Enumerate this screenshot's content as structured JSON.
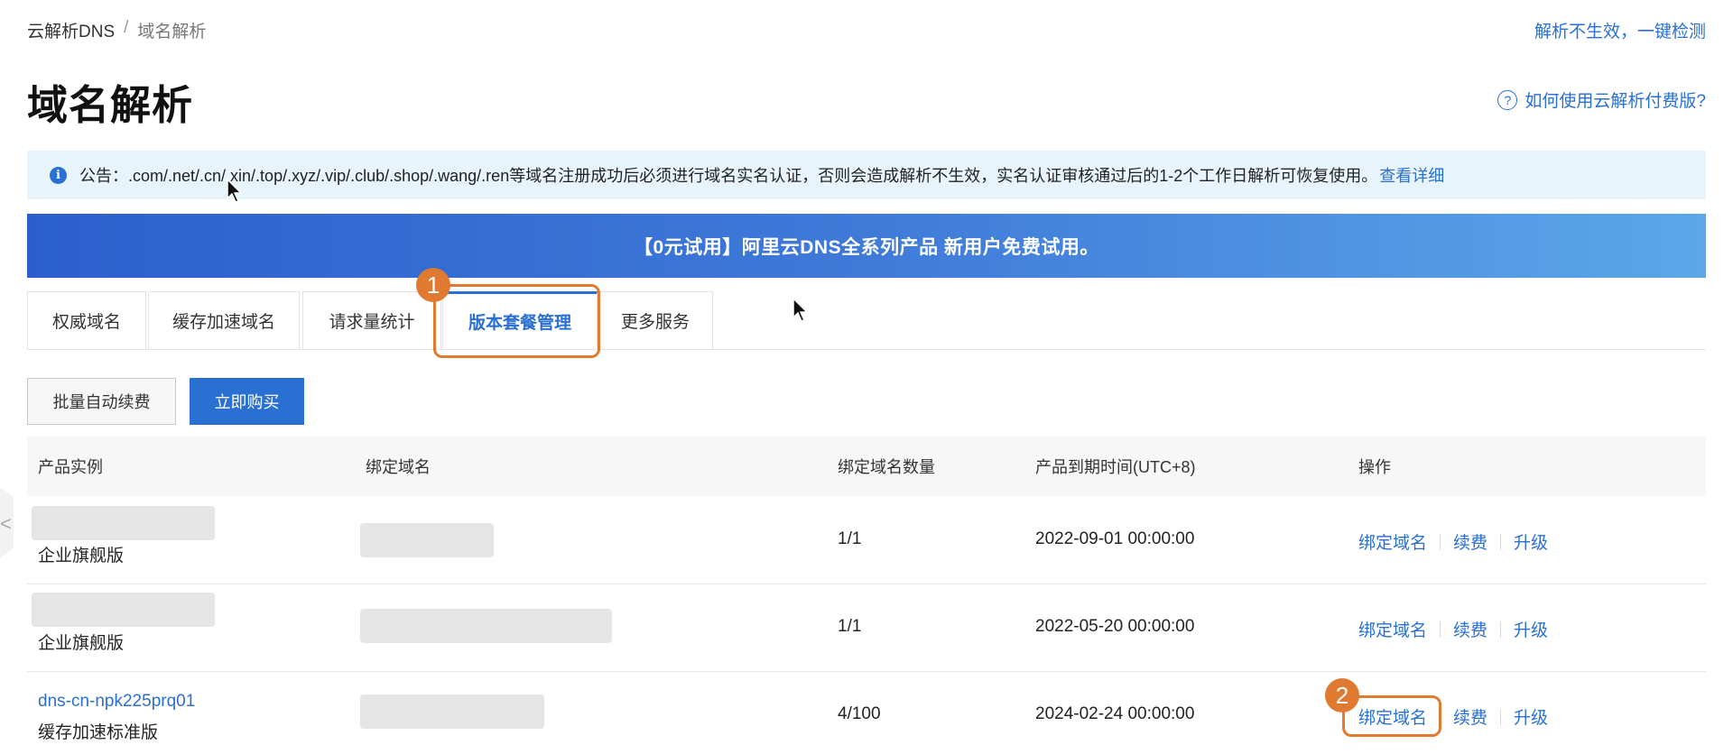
{
  "breadcrumb": {
    "root": "云解析DNS",
    "separator": "/",
    "current": "域名解析"
  },
  "top_link": "解析不生效，一键检测",
  "page_title": "域名解析",
  "help_link": "如何使用云解析付费版?",
  "help_icon": "?",
  "notice": {
    "icon": "i",
    "text": "公告：.com/.net/.cn/.xin/.top/.xyz/.vip/.club/.shop/.wang/.ren等域名注册成功后必须进行域名实名认证，否则会造成解析不生效，实名认证审核通过后的1-2个工作日解析可恢复使用。",
    "link": "查看详细"
  },
  "banner": "【0元试用】阿里云DNS全系列产品 新用户免费试用。",
  "tabs": [
    {
      "label": "权威域名"
    },
    {
      "label": "缓存加速域名"
    },
    {
      "label": "请求量统计"
    },
    {
      "label": "版本套餐管理"
    },
    {
      "label": "更多服务"
    }
  ],
  "buttons": {
    "batch_renew": "批量自动续费",
    "buy_now": "立即购买"
  },
  "table": {
    "headers": [
      "产品实例",
      "绑定域名",
      "绑定域名数量",
      "产品到期时间(UTC+8)",
      "操作"
    ],
    "rows": [
      {
        "instance": "",
        "type": "企业旗舰版",
        "count": "1/1",
        "expiry": "2022-09-01 00:00:00"
      },
      {
        "instance": "",
        "type": "企业旗舰版",
        "count": "1/1",
        "expiry": "2022-05-20 00:00:00"
      },
      {
        "instance": "dns-cn-npk225prq01",
        "type": "缓存加速标准版",
        "count": "4/100",
        "expiry": "2024-02-24 00:00:00"
      }
    ],
    "actions": {
      "bind": "绑定域名",
      "renew": "续费",
      "upgrade": "升级"
    }
  },
  "callouts": [
    "1",
    "2"
  ],
  "side_chevron": "<",
  "colors": {
    "accent": "#2a6fd2",
    "callout": "#e07a30",
    "notice_bg": "#e8f4fb"
  }
}
